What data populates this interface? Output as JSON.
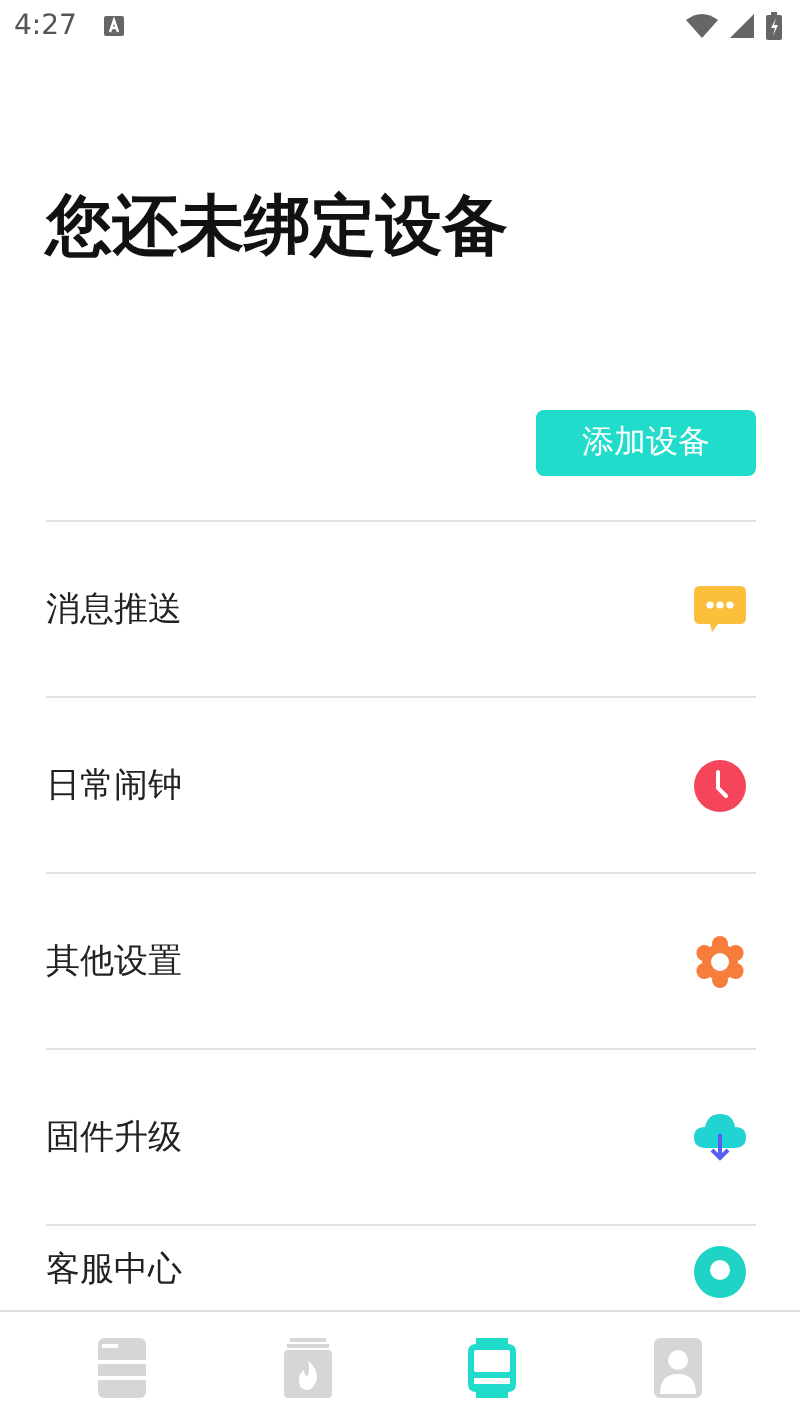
{
  "status_bar": {
    "time": "4:27"
  },
  "title": "您还未绑定设备",
  "add_button": "添加设备",
  "menu": [
    {
      "label": "消息推送",
      "kind": "message"
    },
    {
      "label": "日常闹钟",
      "kind": "alarm"
    },
    {
      "label": "其他设置",
      "kind": "settings"
    },
    {
      "label": "固件升级",
      "kind": "upgrade"
    },
    {
      "label": "客服中心",
      "kind": "support"
    }
  ],
  "tabs": [
    {
      "kind": "list",
      "selected": false
    },
    {
      "kind": "fire",
      "selected": false
    },
    {
      "kind": "watch",
      "selected": true
    },
    {
      "kind": "profile",
      "selected": false
    }
  ]
}
